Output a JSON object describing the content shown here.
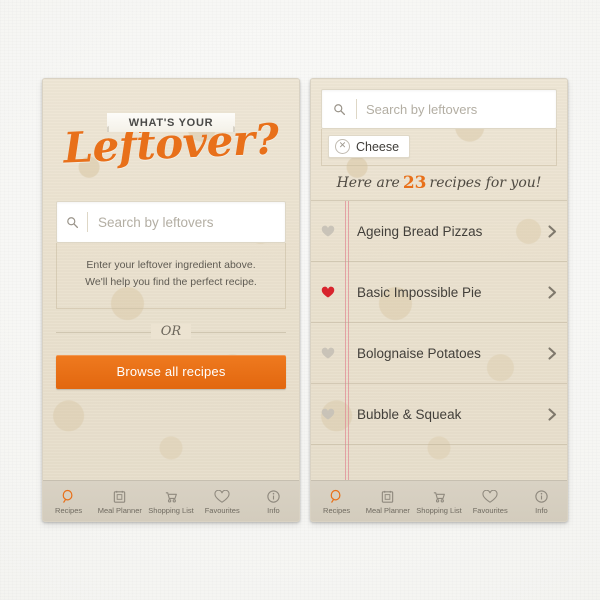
{
  "colors": {
    "accent_orange": "#e8701a",
    "paper": "#ece3d1",
    "tabbar": "#d6cfc0",
    "heart_active": "#d8242e",
    "heart_inactive": "#c9c3b8",
    "rule_pink": "#e28c96",
    "text_dark": "#423f3a",
    "canvas": "#f8f8f6"
  },
  "left_panel": {
    "logo": {
      "ribbon_text": "WHAT'S YOUR",
      "script_text": "Leftover?"
    },
    "search": {
      "placeholder": "Search by leftovers",
      "value": "",
      "icon": "search-icon"
    },
    "hint_line_1": "Enter your leftover ingredient above.",
    "hint_line_2": "We'll help you find the perfect recipe.",
    "or_label": "OR",
    "browse_button": "Browse all recipes"
  },
  "right_panel": {
    "search": {
      "placeholder": "Search by leftovers",
      "value": "",
      "icon": "search-icon"
    },
    "tags": [
      {
        "label": "Cheese",
        "remove_icon": "close-circle-icon"
      }
    ],
    "results_header": {
      "prefix": "Here are",
      "count": "23",
      "suffix": "recipes for you!"
    },
    "recipes": [
      {
        "title": "Ageing Bread Pizzas",
        "favourited": false,
        "chevron": "chevron-right-icon"
      },
      {
        "title": "Basic Impossible Pie",
        "favourited": true,
        "chevron": "chevron-right-icon"
      },
      {
        "title": "Bolognaise Potatoes",
        "favourited": false,
        "chevron": "chevron-right-icon"
      },
      {
        "title": "Bubble & Squeak",
        "favourited": false,
        "chevron": "chevron-right-icon"
      }
    ]
  },
  "tabbar": {
    "items": [
      {
        "label": "Recipes",
        "icon": "magnifier-icon",
        "active": true
      },
      {
        "label": "Meal Planner",
        "icon": "calendar-icon",
        "active": false
      },
      {
        "label": "Shopping List",
        "icon": "shopping-cart-icon",
        "active": false
      },
      {
        "label": "Favourites",
        "icon": "heart-icon",
        "active": false
      },
      {
        "label": "Info",
        "icon": "info-circle-icon",
        "active": false
      }
    ]
  }
}
